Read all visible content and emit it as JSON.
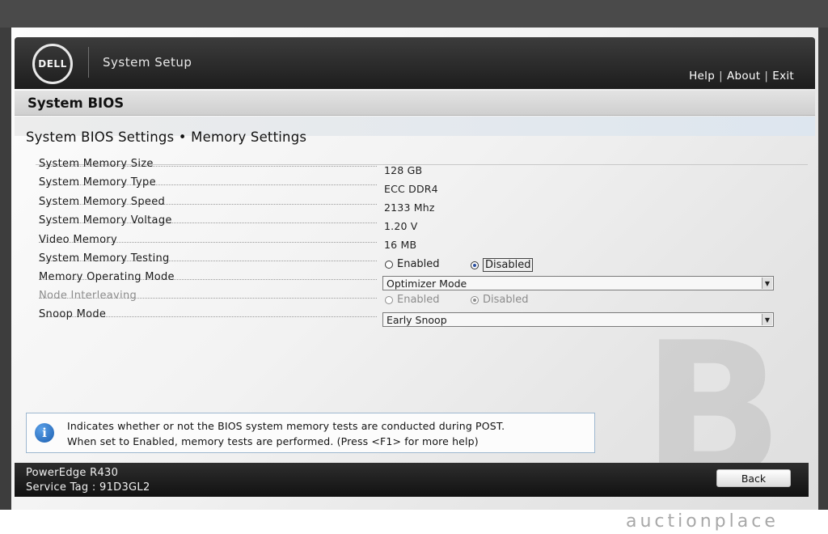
{
  "header": {
    "logo_text": "DELL",
    "app_title": "System Setup",
    "links": [
      "Help",
      "About",
      "Exit"
    ]
  },
  "section": {
    "title": "System BIOS"
  },
  "page": {
    "title": "System BIOS Settings • Memory Settings"
  },
  "settings": {
    "memory_size": {
      "label": "System Memory Size",
      "value": "128 GB"
    },
    "memory_type": {
      "label": "System Memory Type",
      "value": "ECC DDR4"
    },
    "memory_speed": {
      "label": "System Memory Speed",
      "value": "2133 Mhz"
    },
    "memory_voltage": {
      "label": "System Memory Voltage",
      "value": "1.20 V"
    },
    "video_memory": {
      "label": "Video Memory",
      "value": "16 MB"
    },
    "memory_testing": {
      "label": "System Memory Testing",
      "options": [
        "Enabled",
        "Disabled"
      ],
      "selected": "Disabled"
    },
    "operating_mode": {
      "label": "Memory Operating Mode",
      "value": "Optimizer Mode"
    },
    "node_interleaving": {
      "label": "Node Interleaving",
      "options": [
        "Enabled",
        "Disabled"
      ],
      "selected": "Disabled",
      "disabled": true
    },
    "snoop_mode": {
      "label": "Snoop Mode",
      "value": "Early Snoop"
    }
  },
  "help": {
    "line1": "Indicates whether or not the BIOS system memory tests are conducted during POST.",
    "line2": "When set to Enabled, memory tests are performed. (Press <F1> for more help)"
  },
  "footer": {
    "model": "PowerEdge R430",
    "service_tag": "Service Tag : 91D3GL2",
    "back_label": "Back"
  },
  "watermark": {
    "letter": "B",
    "brand": "auctionplace"
  }
}
